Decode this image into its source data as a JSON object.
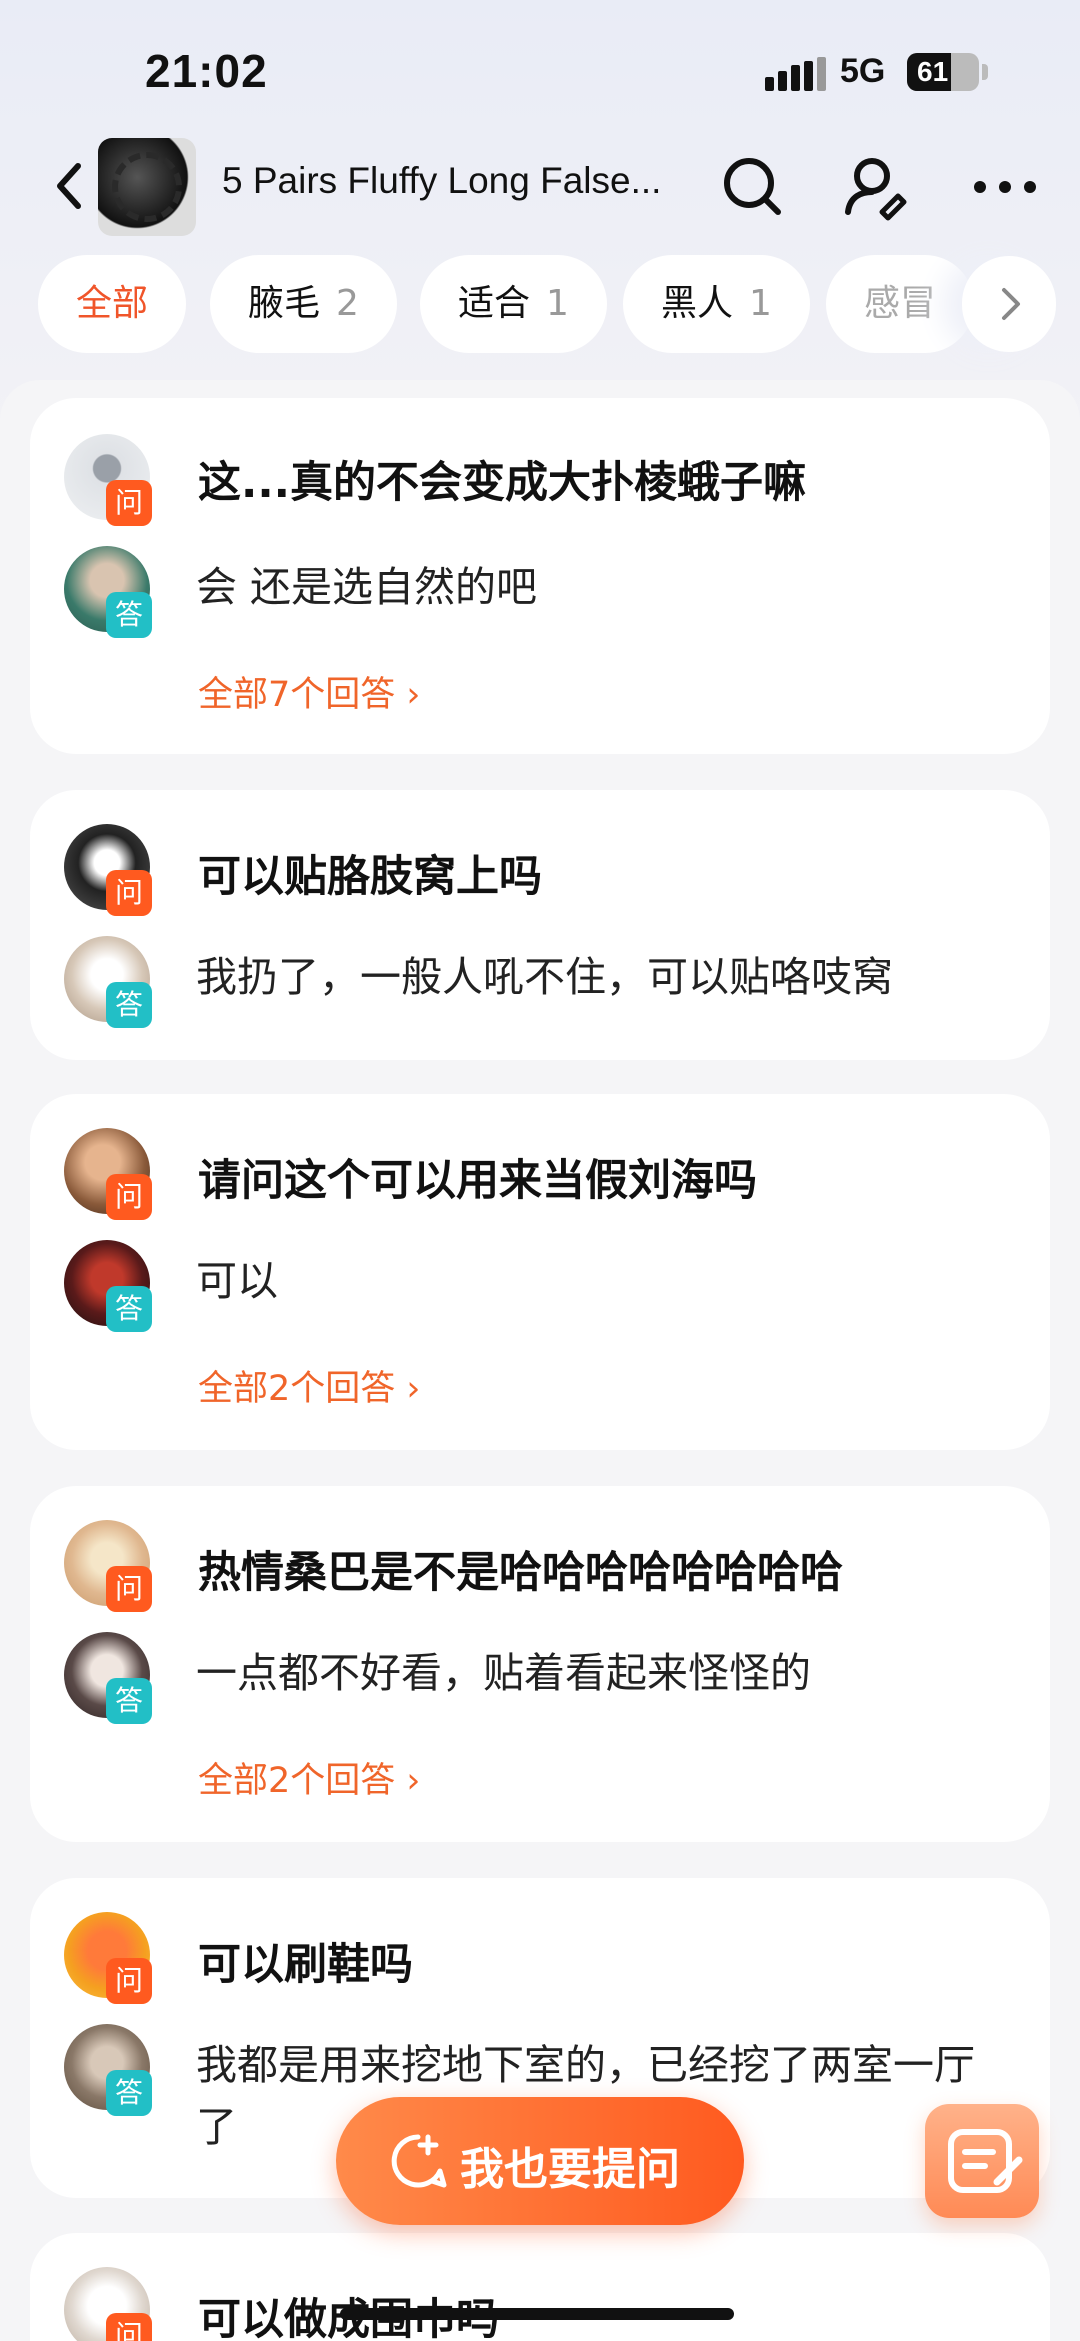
{
  "status_bar": {
    "time": "21:02",
    "network": "5G",
    "battery": "61",
    "battery_level": 0.61
  },
  "header": {
    "title": "5 Pairs Fluffy Long False..."
  },
  "tabs": [
    {
      "label": "全部",
      "count": ""
    },
    {
      "label": "腋毛",
      "count": "2"
    },
    {
      "label": "适合",
      "count": "1"
    },
    {
      "label": "黑人",
      "count": "1"
    },
    {
      "label": "感冒",
      "count": ""
    }
  ],
  "badges": {
    "question": "问",
    "answer": "答"
  },
  "questions": [
    {
      "question": "这...真的不会变成大扑棱蛾子嘛",
      "answer": "会 还是选自然的吧",
      "more": "全部7个回答 ›"
    },
    {
      "question": "可以贴胳肢窝上吗",
      "answer": "我扔了，一般人吼不住，可以贴咯吱窝",
      "more": ""
    },
    {
      "question": "请问这个可以用来当假刘海吗",
      "answer": "可以",
      "more": "全部2个回答 ›"
    },
    {
      "question": "热情桑巴是不是哈哈哈哈哈哈哈哈",
      "answer": "一点都不好看，贴着看起来怪怪的",
      "more": "全部2个回答 ›"
    },
    {
      "question": "可以刷鞋吗",
      "answer": "我都是用来挖地下室的，已经挖了两室一厅了",
      "more": ""
    },
    {
      "question": "可以做成围巾吗",
      "answer": "",
      "more": ""
    }
  ],
  "actions": {
    "ask_label": "我也要提问"
  },
  "colors": {
    "accent": "#ff5a1f",
    "answer_badge": "#22bfc6",
    "link": "#f0652a"
  }
}
